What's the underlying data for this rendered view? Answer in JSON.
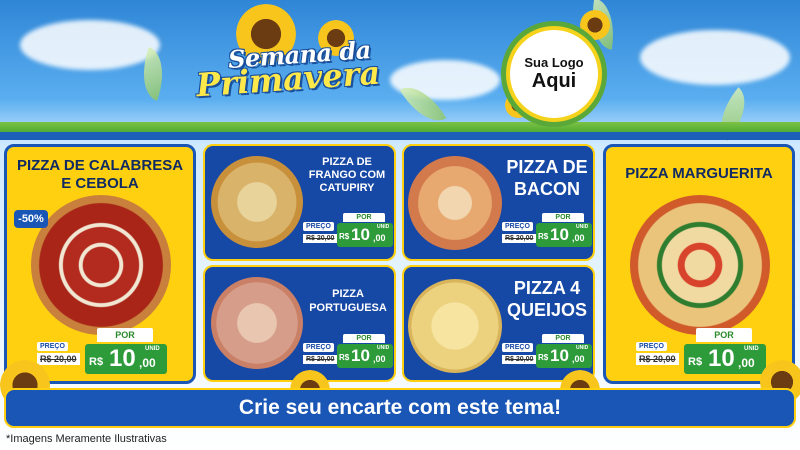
{
  "header": {
    "title_line1": "Semana da",
    "title_line2": "Primavera",
    "logo_line1": "Sua Logo",
    "logo_line2": "Aqui"
  },
  "products": {
    "calabresa": {
      "name_line1": "PIZZA DE CALABRESA",
      "name_line2": "E CEBOLA",
      "discount": "-50%",
      "price_label": "PREÇO",
      "old_price": "R$ 20,00",
      "por": "POR",
      "currency": "R$",
      "price_int": "10",
      "price_dec": ",00",
      "unit": "UNID"
    },
    "frango": {
      "name_line1": "PIZZA DE",
      "name_line2": "FRANGO COM",
      "name_line3": "CATUPIRY",
      "price_label": "PREÇO",
      "old_price": "R$ 20,00",
      "por": "POR",
      "currency": "R$",
      "price_int": "10",
      "price_dec": ",00",
      "unit": "UNID"
    },
    "bacon": {
      "name_line1": "PIZZA DE",
      "name_line2": "BACON",
      "price_label": "PREÇO",
      "old_price": "R$ 20,00",
      "por": "POR",
      "currency": "R$",
      "price_int": "10",
      "price_dec": ",00",
      "unit": "UNID"
    },
    "portuguesa": {
      "name_line1": "PIZZA",
      "name_line2": "PORTUGUESA",
      "price_label": "PREÇO",
      "old_price": "R$ 20,00",
      "por": "POR",
      "currency": "R$",
      "price_int": "10",
      "price_dec": ",00",
      "unit": "UNID"
    },
    "queijos": {
      "name_line1": "PIZZA 4",
      "name_line2": "QUEIJOS",
      "price_label": "PREÇO",
      "old_price": "R$ 20,00",
      "por": "POR",
      "currency": "R$",
      "price_int": "10",
      "price_dec": ",00",
      "unit": "UNID"
    },
    "marguerita": {
      "name_line1": "PIZZA MARGUERITA",
      "price_label": "PREÇO",
      "old_price": "R$ 20,00",
      "por": "POR",
      "currency": "R$",
      "price_int": "10",
      "price_dec": ",00",
      "unit": "UNID"
    }
  },
  "banner": {
    "text": "Crie seu encarte com este tema!"
  },
  "footnote": "*Imagens Meramente Ilustrativas",
  "colors": {
    "yellow": "#ffd00f",
    "blue": "#1648a5",
    "green": "#2e9b3a"
  }
}
